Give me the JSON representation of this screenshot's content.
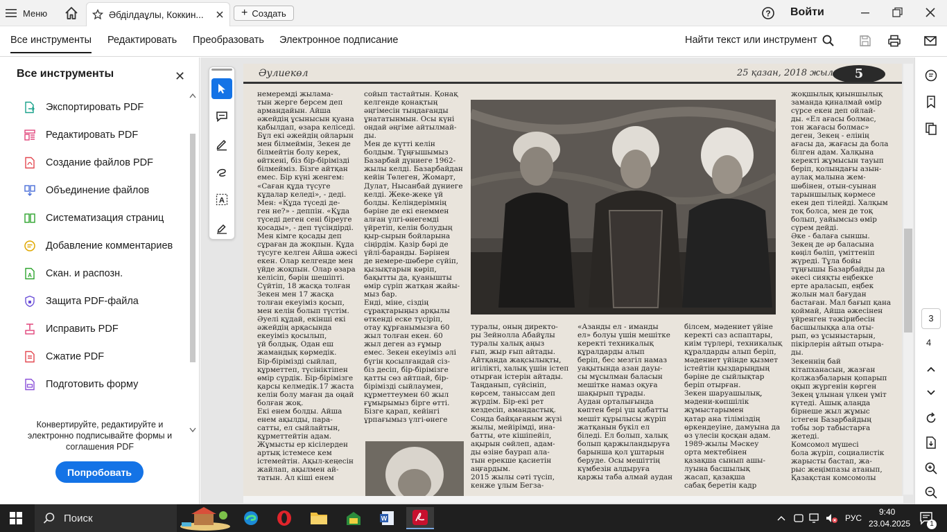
{
  "titlebar": {
    "menu_label": "Меню",
    "tab_title": "Әбділдаұлы, Коккин...",
    "create_label": "Создать",
    "login_label": "Войти"
  },
  "toolbar": {
    "tabs": [
      "Все инструменты",
      "Редактировать",
      "Преобразовать",
      "Электронное подписание"
    ],
    "find_label": "Найти текст или инструмент"
  },
  "left_panel": {
    "title": "Все инструменты",
    "tools": [
      {
        "label": "Экспортировать PDF",
        "icon": "export-pdf-icon",
        "color": "#1aa28b"
      },
      {
        "label": "Редактировать PDF",
        "icon": "edit-pdf-icon",
        "color": "#e0457b"
      },
      {
        "label": "Создание файлов PDF",
        "icon": "create-pdf-icon",
        "color": "#e34850"
      },
      {
        "label": "Объединение файлов",
        "icon": "combine-files-icon",
        "color": "#4b6fd8"
      },
      {
        "label": "Систематизация страниц",
        "icon": "organize-pages-icon",
        "color": "#2da42d"
      },
      {
        "label": "Добавление комментариев",
        "icon": "comment-icon",
        "color": "#e0a800"
      },
      {
        "label": "Скан. и распозн.",
        "icon": "scan-ocr-icon",
        "color": "#2da42d"
      },
      {
        "label": "Защита PDF-файла",
        "icon": "protect-pdf-icon",
        "color": "#6b4fd8"
      },
      {
        "label": "Исправить PDF",
        "icon": "redact-pdf-icon",
        "color": "#e0457b"
      },
      {
        "label": "Сжатие PDF",
        "icon": "compress-pdf-icon",
        "color": "#e34850"
      },
      {
        "label": "Подготовить форму",
        "icon": "prepare-form-icon",
        "color": "#8a4fd8"
      }
    ],
    "promo_text": "Конвертируйте, редактируйте и электронно подписывайте формы и соглашения PDF",
    "try_label": "Попробовать"
  },
  "document": {
    "newspaper_name": "Әулиекөл",
    "date_line": "25 қазан, 2018 жыл",
    "page_number": "5",
    "col1": "немеремді жылама-\nтын жерге берсем деп\nармандайын. Айша\nәжейдің ұсынысын қуана\nқабылдап, өзара келіседі.\nБұл екі әжейдің ойларын\nмен білмеймін, Зекен де\nбілмейтін болу керек,\nөйткені, біз бір-бірімізді\nбілмейміз. Бізге айтқан\nемес. Бір күні женгем:\n«Саған құда түсуге\nкұдалар келеді», - деді.\nМен: «Құда түседі де-\nген не?» - деппін. «Құда\nтүседі деген сені біреуге\nқосады», - деп түсіндірді.\nМен кімге қосады деп\nсұраған да жоқпын. Құда\nтүсуге келген Айша әжесі\nекен. Олар келгенде мен\nүйде жоқпын. Олар өзара\nкелісіп, бәрін шешіпті.\nСүйтіп, 18 жасқа толған\nЗекен мен 17 жасқа\nтолған екеуіміз қосып,\nмен келін болып түстім.\nӘуелі құдай, екіншi екі\nәжейдің арқасында\nекеуіміз қосылып,\nүй болдық. Одан еш\nжамандық көрмедік.\nБір-бірімізді сыйлап,\nқұрметтеп, түсініктіпен\nөмір сүрдік. Бір-бірімізге\nқарсы келмедік.17 жаста\nкелін болу маған да оңай\nболған жоқ.\n   Екі енем болды. Айша\nенем ақылды, пара-\nсатты, ел сыйлайтын,\nқұрметтейтін адам.\nЖұмысты ер кісілерден\nартық істемесе кем\nістемейтін. Ақыл-кеңесін\nжайлап, ақылмен ай-\nтатын. Ал кіші енем",
    "col2": "сойып тастайтын. Қонақ\nкелгенде қонақтың\nәңгімесін тыңдағанды\nұнататынмын. Осы күні\nондай әңгіме айтылмай-\nды.\n   Мен де күтті келін\nболдым. Тұңғышымыз\nБазарбай дүниеге 1962-\nжылы келді. Базарбайдан\nкейін Төлеген, Жомарт,\nДулат, Нысанбай дүниеге\nкелді. Жеке-жеке үй\nболды. Келіндерімнің\nбәріне де екі енеммен\nалған үлгі-өнегемді\nүйретіп, келін болудың\nқыр-сырын бойларына\nсіңірдім. Қазір бәрі де\nүйлі-баранды. Бәрінен\nде немере-шөбере сүйіп,\nқызықтарын көріп,\nбақытты да, қуанышты\nөмір сүріп жатқан жайы-\nмыз бар.\n   Енді, міне, сіздің\nсұрақтарыңыз арқылы\nөткенді еске түсіріп,\nотау құрғанымызға 60\nжыл толған екен. 60\nжыл деген аз ғұмыр\nемес. Зекен екеуіміз әлі\nбүгін қосылғандай сіз-\nбіз десіп, бір-бірімізге\nқатты сөз айтпай, бір-\nбірімізді сыйлаумен,\nқұрметтеумен 60 жыл\nғұмырымыз бірге өтті.\nБізге қарап, кейінгі\nұрпағымыз үлгі-өнеге",
    "col3": "туралы, оның директо-\nры Зейнолла Абайұлы\nтуралы халық аңыз\nғып, жыр ғып айтады.\nАйтқанда жақсылықты,\nигілікті, халық үшін істеп\nотырған істерін айтады.\n   Таңданып, сүйсініп,\nкөрсем, таныссам деп\nжүрдім. Бір-екі рет\nкездесіп, амандастық.\nСонда байқағаным жүзі\nжылы, мейірімді, ина-\nбатты, өте кішіпейіл,\nақырын сөйлеп, адам-\nды өзіне баурап ала-\nтын ерекше қасиетін\nаңғардым.\n   2015 жылы сәті түсіп,\nкенже ұлым Бегза-",
    "col4": "   «Азанды ел - иманды\nел» болуы үшін мешітке\nкеректі техникалық\nқұралдарды алып\nберіп, бес мезгіл намаз\nуақытында азан дауы-\nсы мұсылман баласын\nмешітке намаз оқуға\nшақырып тұрады.\n   Аудан орталығында\nкөптен бері үш қабатты\nмешіт құрылысы жүріп\nжатқанын бүкіл ел\nбіледі. Ел болып, халық\nболып қаржыландыруға\nбарынша қол ұштарын\nберуде. Осы мешіттің\nкүмбезін алдыруға\nқаржы таба алмай аудан",
    "col5": "білсем, мәдениет үйіне\nкеректі саз аспаптары,\nкиім түрлері, техникалық\nқұралдарды алып беріп,\nмәдениет үйінде қызмет\nістейтін қыздарыңдың\nбәріне де сыйлықтар\nберіп отырған.\n   Зекен шаруашылық,\nмәдени-көпшілік\nжұмыстарымен\nқатар ана тіліміздің\nөркендеуіне, дамуына да\nөз үлесін қосқан адам.\n   1989-жылы Мәскеу\nорта мектебінен\nқазақша сынып ашы-\nлуына басшылық\nжасап, қазақша\nсабақ беретін кадр",
    "col6": "жоқшылық қиыншылық\nзаманда қиналмай өмір\nсүрсе екен деп ойлай-\nды. «Ел ағасы болмас,\nтон жағасы болмас»\nдеген, Зекең - елінің\nағасы да, жағасы да бола\nбілген адам. Халқына\nкеректі жұмысын тауып\nберіп, қолындағы азын-\nаулақ малына жем-\nшөбінен, отын-суынан\nтарыншылық көрмесе\nекен деп тілейді. Халқым\nтоқ болса, мен де тоқ\nболып, уайымсыз өмір\nсүрем дейді.\n   Әке - балаға сыншы.\nЗекең де әр баласына\nкөңіл бөліп, үміттеніп\nжүреді. Тұла бойы\nтұңғышы Базарбайды да\nәкесі сияқты еңбекке\nерте араласып, еңбек\nжолын мал бағудан\nбастаған. Мал бағып қана\nқоймай, Айша әжесінен\nүйренген тәжірибесін\nбасшылыққа ала оты-\nрып, өз ұсыныстарын,\nпікірлерін айтып отыра-\nды.\n   Зекеннің бай\nкітапханасын, жазған\nқолжазбаларын қопарып\nоқып жүргенін көрген\nЗекең ұлынан үлкен үміт\nкүтеді. Ашық алаңда\nбірнеше жыл жұмыс\nістеген Базарбайдың\nтобы зор табыстарға\nжетеді.\n   Комсомол мүшесі\nбола жүріп, социалистік\nжарысты бастап, жа-\nрыс жеңімпазы атанып,\nҚазақстан комсомолы"
  },
  "right_rail": {
    "current_page": "3",
    "next_page": "4"
  },
  "taskbar": {
    "search_label": "Поиск",
    "lang": "РУС",
    "time": "9:40",
    "date": "23.04.2025",
    "notification_count": "1"
  }
}
